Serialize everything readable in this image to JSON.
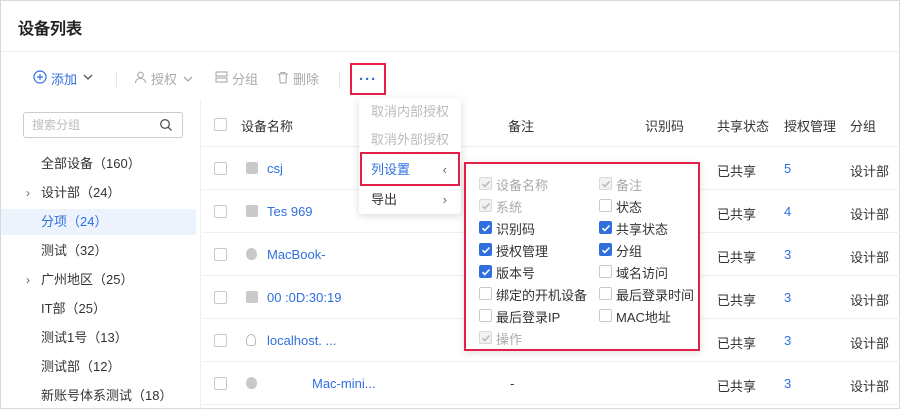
{
  "page": {
    "title": "设备列表"
  },
  "toolbar": {
    "add": "添加",
    "authorize": "授权",
    "group": "分组",
    "delete": "删除",
    "more": "···"
  },
  "sidebar": {
    "search_placeholder": "搜索分组",
    "groups": [
      {
        "label": "全部设备（160）",
        "expandable": false,
        "selected": false
      },
      {
        "label": "设计部（24）",
        "expandable": true,
        "selected": false
      },
      {
        "label": "分项（24）",
        "expandable": false,
        "selected": true
      },
      {
        "label": "测试（32）",
        "expandable": false,
        "selected": false
      },
      {
        "label": "广州地区（25）",
        "expandable": true,
        "selected": false
      },
      {
        "label": "IT部（25）",
        "expandable": false,
        "selected": false
      },
      {
        "label": "测试1号（13）",
        "expandable": false,
        "selected": false
      },
      {
        "label": "测试部（12）",
        "expandable": false,
        "selected": false
      },
      {
        "label": "新账号体系测试（18）",
        "expandable": false,
        "selected": false
      }
    ]
  },
  "table": {
    "headers": {
      "name": "设备名称",
      "note": "备注",
      "id_code": "识别码",
      "share": "共享状态",
      "auth": "授权管理",
      "group": "分组"
    },
    "rows": [
      {
        "icon": "windows-icon",
        "name": "csj",
        "note": "",
        "share": "已共享",
        "auth": "5",
        "group": "设计部"
      },
      {
        "icon": "windows-icon",
        "name": "Tes          969",
        "note": "",
        "share": "已共享",
        "auth": "4",
        "group": "设计部"
      },
      {
        "icon": "apple-icon",
        "name": "MacBook-",
        "note": "",
        "share": "已共享",
        "auth": "3",
        "group": "设计部"
      },
      {
        "icon": "windows-icon",
        "name": "00          :0D:30:19",
        "note": "",
        "share": "已共享",
        "auth": "3",
        "group": "设计部"
      },
      {
        "icon": "linux-icon",
        "name": "localhost.          ...",
        "note": "",
        "share": "已共享",
        "auth": "3",
        "group": "设计部"
      },
      {
        "icon": "apple-icon",
        "name": "Mac-mini...",
        "note": "-",
        "share": "已共享",
        "auth": "3",
        "group": "设计部"
      }
    ]
  },
  "more_menu": {
    "items": [
      {
        "label": "取消内部授权",
        "state": "disabled"
      },
      {
        "label": "取消外部授权",
        "state": "disabled"
      },
      {
        "label": "列设置",
        "state": "active",
        "chevron": "‹"
      },
      {
        "label": "导出",
        "state": "normal",
        "chevron": "›"
      }
    ]
  },
  "column_settings": {
    "options": [
      {
        "label": "设备名称",
        "checked": true,
        "locked": true
      },
      {
        "label": "备注",
        "checked": true,
        "locked": true
      },
      {
        "label": "系统",
        "checked": true,
        "locked": true
      },
      {
        "label": "状态",
        "checked": false,
        "locked": false
      },
      {
        "label": "识别码",
        "checked": true,
        "locked": false
      },
      {
        "label": "共享状态",
        "checked": true,
        "locked": false
      },
      {
        "label": "授权管理",
        "checked": true,
        "locked": false
      },
      {
        "label": "分组",
        "checked": true,
        "locked": false
      },
      {
        "label": "版本号",
        "checked": true,
        "locked": false
      },
      {
        "label": "域名访问",
        "checked": false,
        "locked": false
      },
      {
        "label": "绑定的开机设备",
        "checked": false,
        "locked": false
      },
      {
        "label": "最后登录时间",
        "checked": false,
        "locked": false
      },
      {
        "label": "最后登录IP",
        "checked": false,
        "locked": false
      },
      {
        "label": "MAC地址",
        "checked": false,
        "locked": false
      },
      {
        "label": "操作",
        "checked": true,
        "locked": true
      }
    ]
  },
  "colors": {
    "primary": "#2f6fde",
    "highlight": "#e3204a"
  }
}
